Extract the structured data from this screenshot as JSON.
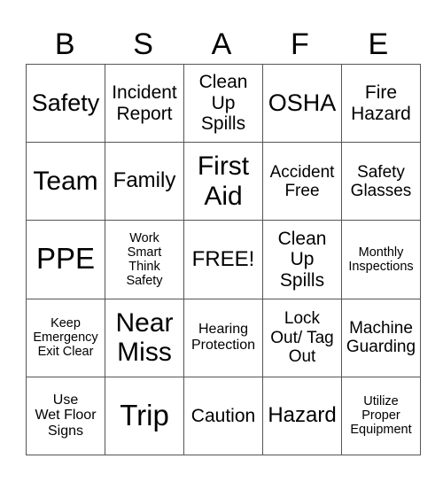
{
  "header": {
    "letters": [
      "B",
      "S",
      "A",
      "F",
      "E"
    ]
  },
  "grid": {
    "rows": [
      [
        "Safety",
        "Incident\nReport",
        "Clean\nUp\nSpills",
        "OSHA",
        "Fire\nHazard"
      ],
      [
        "Team",
        "Family",
        "First\nAid",
        "Accident\nFree",
        "Safety\nGlasses"
      ],
      [
        "PPE",
        "Work\nSmart\nThink\nSafety",
        "FREE!",
        "Clean\nUp\nSpills",
        "Monthly\nInspections"
      ],
      [
        "Keep\nEmergency\nExit Clear",
        "Near\nMiss",
        "Hearing\nProtection",
        "Lock\nOut/ Tag\nOut",
        "Machine\nGuarding"
      ],
      [
        "Use\nWet Floor\nSigns",
        "Trip",
        "Caution",
        "Hazard",
        "Utilize\nProper\nEquipment"
      ]
    ]
  }
}
